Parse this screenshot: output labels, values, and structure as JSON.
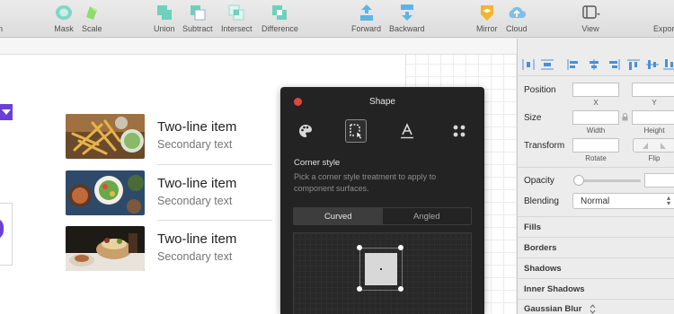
{
  "toolbar": {
    "cut_label": "n",
    "mask": "Mask",
    "scale": "Scale",
    "union": "Union",
    "subtract": "Subtract",
    "intersect": "Intersect",
    "difference": "Difference",
    "forward": "Forward",
    "backward": "Backward",
    "mirror": "Mirror",
    "cloud": "Cloud",
    "view": "View",
    "export": "Export"
  },
  "list": {
    "items": [
      {
        "primary": "Two-line item",
        "secondary": "Secondary text",
        "image": "fries-photo"
      },
      {
        "primary": "Two-line item",
        "secondary": "Secondary text",
        "image": "salad-bowls-photo"
      },
      {
        "primary": "Two-line item",
        "secondary": "Secondary text",
        "image": "dessert-photo"
      }
    ]
  },
  "shape_panel": {
    "title": "Shape",
    "tabs": [
      "palette-icon",
      "corner-style-icon",
      "typography-icon",
      "more-icon"
    ],
    "active_tab": "corner-style-icon",
    "section_title": "Corner style",
    "section_desc": "Pick a corner style treatment to apply to component surfaces.",
    "segments": [
      "Curved",
      "Angled"
    ],
    "selected_segment": "Curved"
  },
  "inspector": {
    "position": "Position",
    "x": "X",
    "y": "Y",
    "size": "Size",
    "width": "Width",
    "height": "Height",
    "transform": "Transform",
    "rotate": "Rotate",
    "flip": "Flip",
    "opacity": "Opacity",
    "blending": "Blending",
    "blending_value": "Normal",
    "sections": [
      "Fills",
      "Borders",
      "Shadows",
      "Inner Shadows",
      "Gaussian Blur"
    ]
  },
  "colors": {
    "accent_purple": "#6b3fd6",
    "panel_bg": "#232323",
    "close_red": "#e5453a",
    "toolbar_icon_teal": "#5fc9b3",
    "mirror_yellow": "#f2b62c",
    "cloud_blue": "#64aee0"
  }
}
